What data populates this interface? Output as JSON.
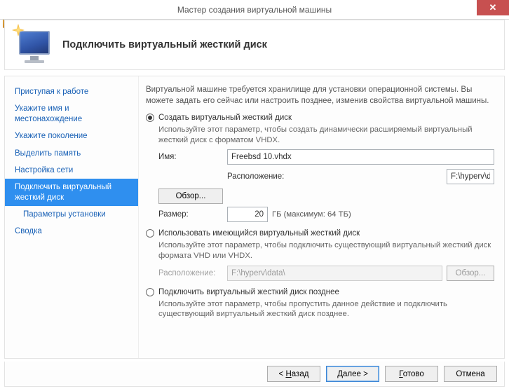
{
  "titlebar": {
    "title": "Мастер создания виртуальной машины"
  },
  "header": {
    "title": "Подключить виртуальный жесткий диск"
  },
  "sidebar": {
    "items": [
      {
        "label": "Приступая к работе",
        "selected": false,
        "indent": false
      },
      {
        "label": "Укажите имя и местонахождение",
        "selected": false,
        "indent": false
      },
      {
        "label": "Укажите поколение",
        "selected": false,
        "indent": false
      },
      {
        "label": "Выделить память",
        "selected": false,
        "indent": false
      },
      {
        "label": "Настройка сети",
        "selected": false,
        "indent": false
      },
      {
        "label": "Подключить виртуальный жесткий диск",
        "selected": true,
        "indent": false
      },
      {
        "label": "Параметры установки",
        "selected": false,
        "indent": true
      },
      {
        "label": "Сводка",
        "selected": false,
        "indent": false
      }
    ]
  },
  "content": {
    "intro": "Виртуальной машине требуется хранилище для установки операционной системы. Вы можете задать его сейчас или настроить позднее, изменив свойства виртуальной машины.",
    "opt1": {
      "label": "Создать виртуальный жесткий диск",
      "desc": "Используйте этот параметр, чтобы создать динамически расширяемый виртуальный жесткий диск с форматом VHDX.",
      "name_label": "Имя:",
      "name_value": "Freebsd 10.vhdx",
      "loc_label": "Расположение:",
      "loc_value": "F:\\hyperv\\data\\",
      "browse": "Обзор...",
      "size_label": "Размер:",
      "size_value": "20",
      "size_unit": "ГБ (максимум: 64 ТБ)"
    },
    "opt2": {
      "label": "Использовать имеющийся виртуальный жесткий диск",
      "desc": "Используйте этот параметр, чтобы подключить существующий виртуальный жесткий диск формата VHD или VHDX.",
      "loc_label": "Расположение:",
      "loc_value": "F:\\hyperv\\data\\",
      "browse": "Обзор..."
    },
    "opt3": {
      "label": "Подключить виртуальный жесткий диск позднее",
      "desc": "Используйте этот параметр, чтобы пропустить данное действие и подключить существующий виртуальный жесткий диск позднее."
    }
  },
  "footer": {
    "back_u": "Н",
    "back_rest": "азад",
    "next_u": "Д",
    "next_rest": "алее",
    "finish_u": "Г",
    "finish_rest": "отово",
    "cancel": "Отмена"
  }
}
